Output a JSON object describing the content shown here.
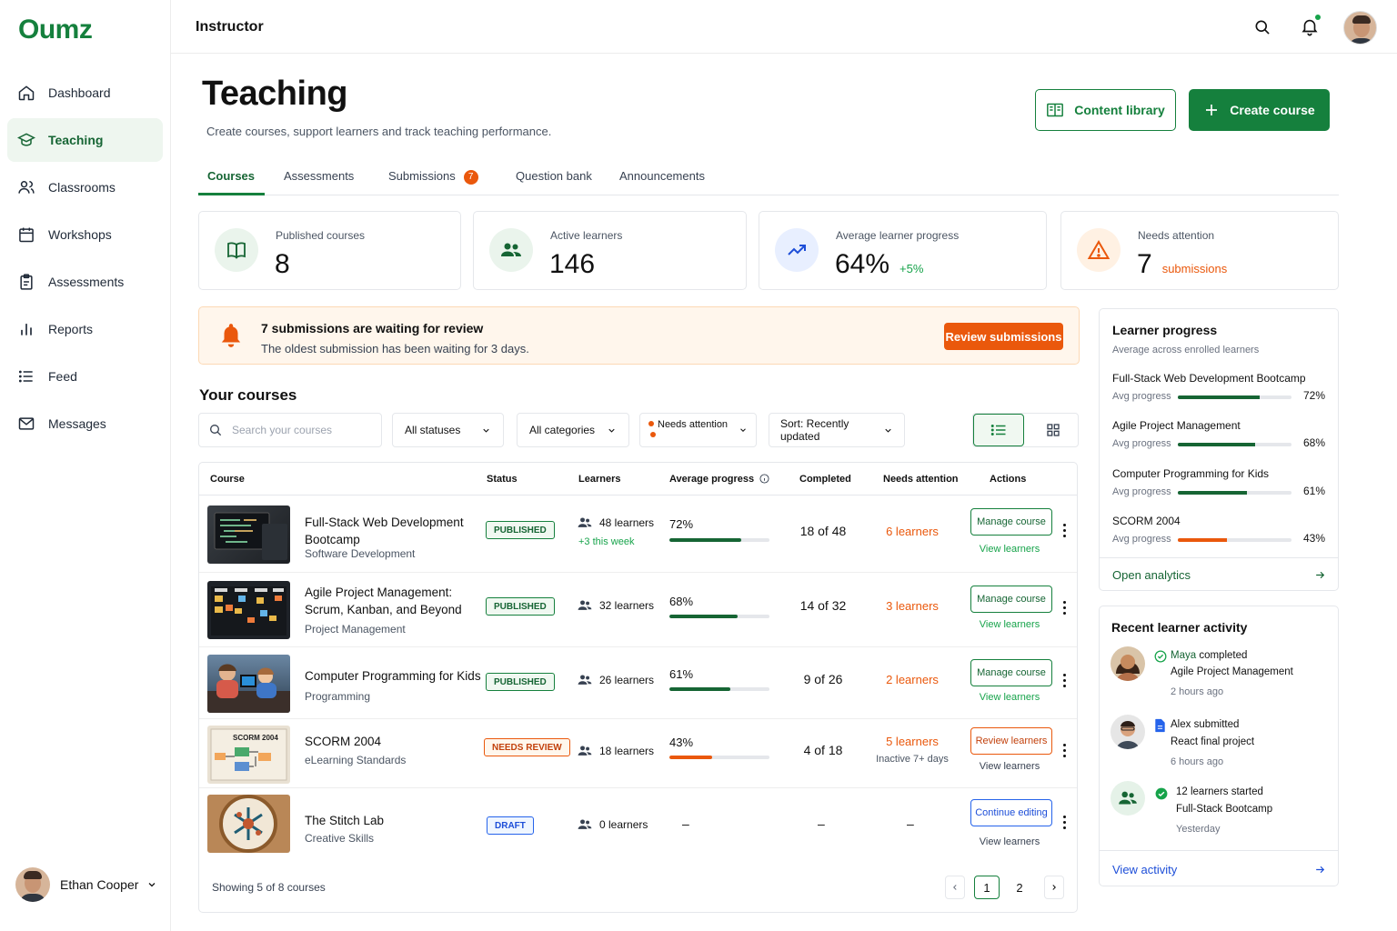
{
  "app": {
    "logo": "Oumz",
    "section_title": "Instructor"
  },
  "sidebar": {
    "items": [
      {
        "label": "Dashboard",
        "icon": "home-icon"
      },
      {
        "label": "Teaching",
        "icon": "graduation-cap-icon",
        "active": true
      },
      {
        "label": "Classrooms",
        "icon": "users-icon"
      },
      {
        "label": "Workshops",
        "icon": "calendar-icon"
      },
      {
        "label": "Assessments",
        "icon": "clipboard-icon"
      },
      {
        "label": "Reports",
        "icon": "bar-chart-icon"
      },
      {
        "label": "Feed",
        "icon": "list-icon"
      },
      {
        "label": "Messages",
        "icon": "mail-icon"
      }
    ],
    "user": {
      "name": "Ethan Cooper"
    }
  },
  "header": {
    "title": "Teaching",
    "subtitle": "Create courses, support learners and track teaching performance.",
    "content_library_label": "Content library",
    "create_course_label": "Create course"
  },
  "tabs": [
    {
      "label": "Courses",
      "active": true
    },
    {
      "label": "Assessments"
    },
    {
      "label": "Submissions",
      "badge": "7"
    },
    {
      "label": "Question bank"
    },
    {
      "label": "Announcements"
    }
  ],
  "stats": {
    "published": {
      "label": "Published courses",
      "value": "8"
    },
    "learners": {
      "label": "Active learners",
      "value": "146"
    },
    "progress": {
      "label": "Average learner progress",
      "value": "64%",
      "delta": "+5%"
    },
    "attention": {
      "label": "Needs attention",
      "value": "7",
      "suffix": "submissions"
    }
  },
  "alert": {
    "title": "7 submissions are waiting for review",
    "message": "The oldest submission has been waiting for 3 days.",
    "button": "Review submissions"
  },
  "courses": {
    "title": "Your courses",
    "search_placeholder": "Search your courses",
    "filters": {
      "status": "All statuses",
      "category": "All categories",
      "attention": "Needs attention",
      "sort": "Sort: Recently updated"
    },
    "columns": [
      "Course",
      "Status",
      "Learners",
      "Average progress",
      "Completed",
      "Needs attention",
      "Actions"
    ],
    "rows": [
      {
        "name": "Full-Stack Web Development Bootcamp",
        "category": "Software Development",
        "status": "PUBLISHED",
        "learners": "48 learners",
        "learners_sub": "+3 this week",
        "progress_label": "72%",
        "progress": 0.72,
        "completed": "18 of 48",
        "needs": "6 learners",
        "action": "Manage course",
        "link": "View learners"
      },
      {
        "name": "Agile Project Management: Scrum, Kanban, and Beyond",
        "category": "Project Management",
        "status": "PUBLISHED",
        "learners": "32 learners",
        "progress_label": "68%",
        "progress": 0.68,
        "completed": "14 of 32",
        "needs": "3 learners",
        "action": "Manage course",
        "link": "View learners"
      },
      {
        "name": "Computer Programming for Kids",
        "category": "Programming",
        "status": "PUBLISHED",
        "learners": "26 learners",
        "progress_label": "61%",
        "progress": 0.61,
        "completed": "9 of 26",
        "needs": "2 learners",
        "action": "Manage course",
        "link": "View learners"
      },
      {
        "name": "SCORM 2004",
        "category": "eLearning Standards",
        "status": "NEEDS REVIEW",
        "learners": "18 learners",
        "progress_label": "43%",
        "progress": 0.43,
        "completed": "4 of 18",
        "needs": "5 learners",
        "needs_sub": "Inactive 7+ days",
        "action": "Review learners",
        "link": "View learners",
        "thumb_text": "SCORM 2004"
      },
      {
        "name": "The Stitch Lab",
        "category": "Creative Skills",
        "status": "DRAFT",
        "learners": "0 learners",
        "progress_label": "–",
        "completed": "–",
        "needs": "–",
        "action": "Continue editing",
        "link": "View learners"
      }
    ],
    "footer": "Showing 5 of 8 courses",
    "pages": [
      "1",
      "2"
    ]
  },
  "learner_progress": {
    "title": "Learner progress",
    "subtitle": "Average across enrolled learners",
    "avg_label": "Avg progress",
    "items": [
      {
        "name": "Full-Stack Web Development Bootcamp",
        "pct_label": "72%",
        "pct": 0.72
      },
      {
        "name": "Agile Project Management",
        "pct_label": "68%",
        "pct": 0.68
      },
      {
        "name": "Computer Programming for Kids",
        "pct_label": "61%",
        "pct": 0.61
      },
      {
        "name": "SCORM 2004",
        "pct_label": "43%",
        "pct": 0.43
      }
    ],
    "link": "Open analytics"
  },
  "activity": {
    "title": "Recent learner activity",
    "items": [
      {
        "actor": "Maya",
        "verb": " completed",
        "object": "Agile Project Management",
        "time": "2 hours ago"
      },
      {
        "actor": "Alex submitted",
        "object": "React final project",
        "time": "6 hours ago"
      },
      {
        "actor": "12 learners started",
        "object": "Full-Stack Bootcamp",
        "time": "Yesterday"
      }
    ],
    "link": "View activity"
  },
  "colors": {
    "primary": "#15803d",
    "warning": "#ea580c",
    "info": "#1d4ed8"
  }
}
